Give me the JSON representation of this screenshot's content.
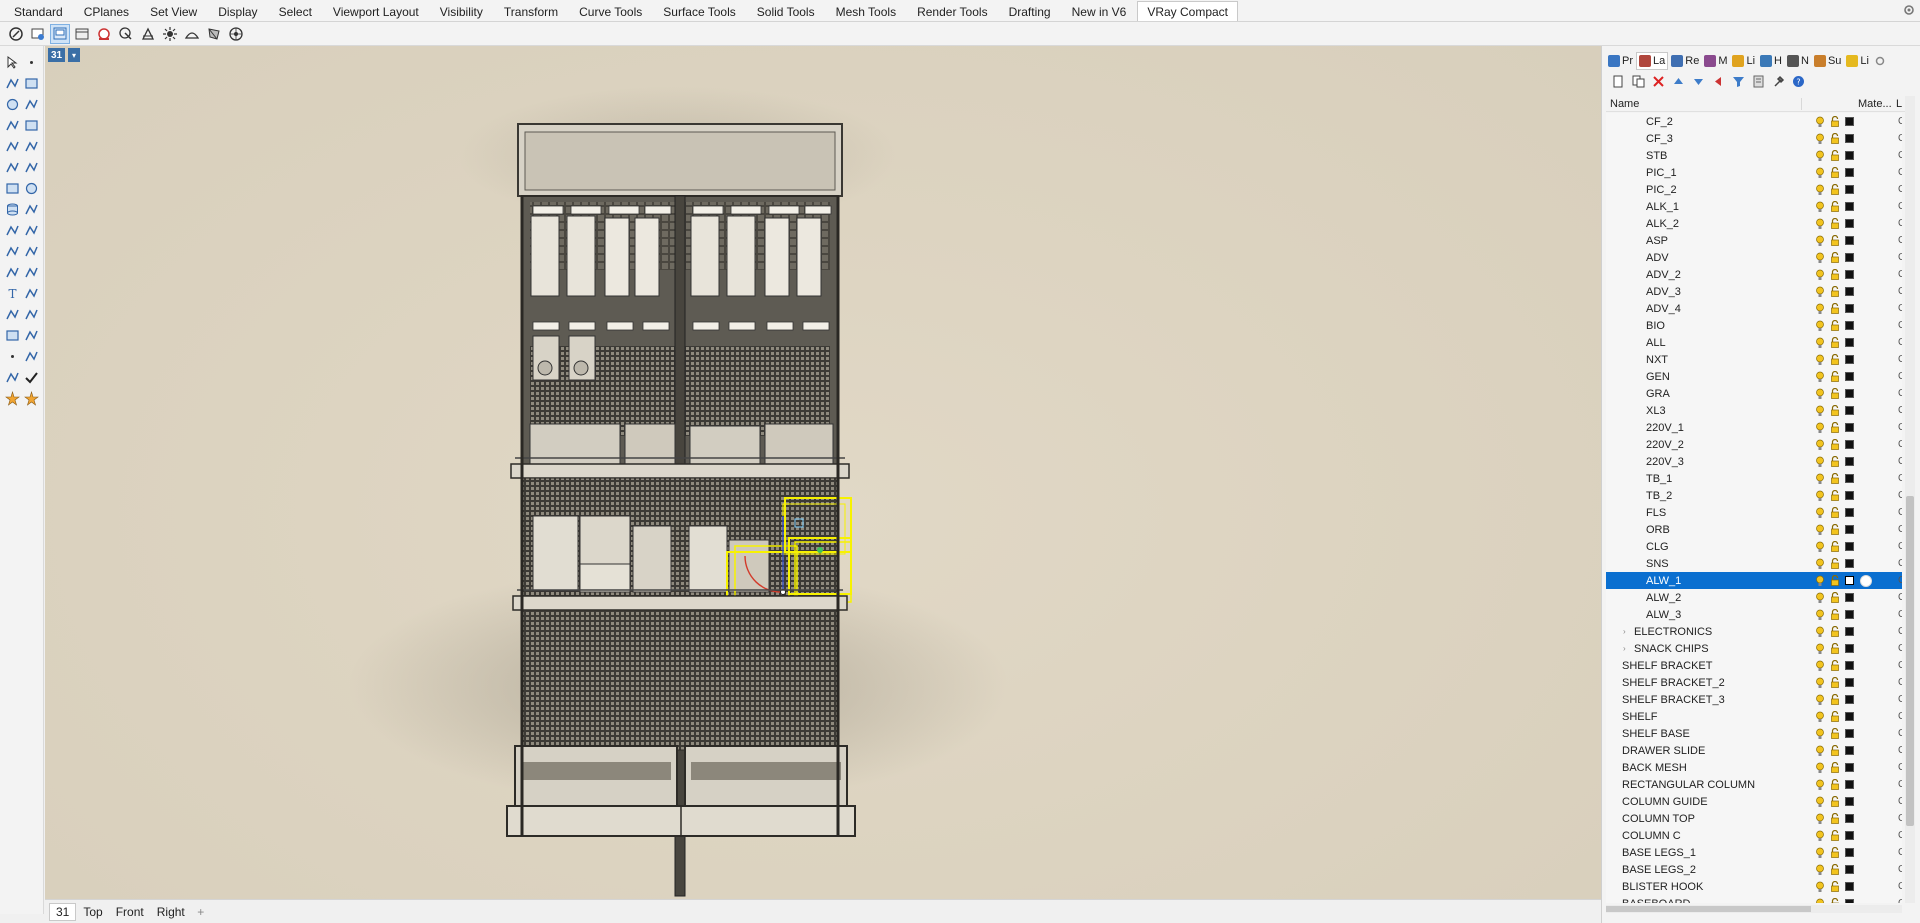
{
  "tabs": [
    {
      "label": "Standard"
    },
    {
      "label": "CPlanes"
    },
    {
      "label": "Set View"
    },
    {
      "label": "Display"
    },
    {
      "label": "Select"
    },
    {
      "label": "Viewport Layout"
    },
    {
      "label": "Visibility"
    },
    {
      "label": "Transform"
    },
    {
      "label": "Curve Tools"
    },
    {
      "label": "Surface Tools"
    },
    {
      "label": "Solid Tools"
    },
    {
      "label": "Mesh Tools"
    },
    {
      "label": "Render Tools"
    },
    {
      "label": "Drafting"
    },
    {
      "label": "New in V6"
    },
    {
      "label": "VRay Compact"
    }
  ],
  "active_tab": "VRay Compact",
  "toolbar": {
    "icons": [
      "vray-logo-icon",
      "vray-render-icon",
      "vray-frame-buffer-icon",
      "vray-interactive-icon",
      "vray-material-icon",
      "vray-sphere-icon",
      "vray-light-icon",
      "vray-sun-icon",
      "vray-dome-icon",
      "vray-proxy-icon",
      "vray-settings-icon"
    ]
  },
  "viewport": {
    "label": "31",
    "dropdown": "▾",
    "background": "#ddd4c1"
  },
  "viewport_tabs": [
    {
      "label": "31"
    },
    {
      "label": "Top"
    },
    {
      "label": "Front"
    },
    {
      "label": "Right"
    }
  ],
  "viewport_tab_add": "+",
  "panel": {
    "tabs": [
      {
        "label": "Pr",
        "color": "#3a76c2"
      },
      {
        "label": "La",
        "color": "#b0463c"
      },
      {
        "label": "Re",
        "color": "#3f6fb2"
      },
      {
        "label": "M",
        "color": "#8a4a8e"
      },
      {
        "label": "Li",
        "color": "#e0a31f"
      },
      {
        "label": "H",
        "color": "#3b79b7"
      },
      {
        "label": "N",
        "color": "#555555"
      },
      {
        "label": "Su",
        "color": "#c97e2b"
      },
      {
        "label": "Li",
        "color": "#e5b91f"
      }
    ],
    "active_tab": "La",
    "header": {
      "name": "Name",
      "material": "Mate...",
      "linetype": "L"
    },
    "layers": [
      {
        "name": "CF_2",
        "indent": 2
      },
      {
        "name": "CF_3",
        "indent": 2
      },
      {
        "name": "STB",
        "indent": 2
      },
      {
        "name": "PIC_1",
        "indent": 2
      },
      {
        "name": "PIC_2",
        "indent": 2
      },
      {
        "name": "ALK_1",
        "indent": 2
      },
      {
        "name": "ALK_2",
        "indent": 2
      },
      {
        "name": "ASP",
        "indent": 2
      },
      {
        "name": "ADV",
        "indent": 2
      },
      {
        "name": "ADV_2",
        "indent": 2
      },
      {
        "name": "ADV_3",
        "indent": 2
      },
      {
        "name": "ADV_4",
        "indent": 2
      },
      {
        "name": "BIO",
        "indent": 2
      },
      {
        "name": "ALL",
        "indent": 2
      },
      {
        "name": "NXT",
        "indent": 2
      },
      {
        "name": "GEN",
        "indent": 2
      },
      {
        "name": "GRA",
        "indent": 2
      },
      {
        "name": "XL3",
        "indent": 2
      },
      {
        "name": "220V_1",
        "indent": 2
      },
      {
        "name": "220V_2",
        "indent": 2
      },
      {
        "name": "220V_3",
        "indent": 2
      },
      {
        "name": "TB_1",
        "indent": 2
      },
      {
        "name": "TB_2",
        "indent": 2
      },
      {
        "name": "FLS",
        "indent": 2
      },
      {
        "name": "ORB",
        "indent": 2
      },
      {
        "name": "CLG",
        "indent": 2
      },
      {
        "name": "SNS",
        "indent": 2
      },
      {
        "name": "ALW_1",
        "indent": 2,
        "selected": true
      },
      {
        "name": "ALW_2",
        "indent": 2
      },
      {
        "name": "ALW_3",
        "indent": 2
      },
      {
        "name": "ELECTRONICS",
        "indent": 1,
        "expandable": true
      },
      {
        "name": "SNACK CHIPS",
        "indent": 1,
        "expandable": true
      },
      {
        "name": "SHELF BRACKET",
        "indent": 0
      },
      {
        "name": "SHELF BRACKET_2",
        "indent": 0
      },
      {
        "name": "SHELF BRACKET_3",
        "indent": 0
      },
      {
        "name": "SHELF",
        "indent": 0
      },
      {
        "name": "SHELF BASE",
        "indent": 0
      },
      {
        "name": "DRAWER SLIDE",
        "indent": 0
      },
      {
        "name": "BACK MESH",
        "indent": 0
      },
      {
        "name": "RECTANGULAR COLUMN",
        "indent": 0
      },
      {
        "name": "COLUMN GUIDE",
        "indent": 0
      },
      {
        "name": "COLUMN TOP",
        "indent": 0
      },
      {
        "name": "COLUMN C",
        "indent": 0
      },
      {
        "name": "BASE LEGS_1",
        "indent": 0
      },
      {
        "name": "BASE LEGS_2",
        "indent": 0
      },
      {
        "name": "BLISTER HOOK",
        "indent": 0
      },
      {
        "name": "BASEBOARD",
        "indent": 0
      }
    ],
    "column_l_glyph": "C"
  },
  "colors": {
    "selection_blue": "#0a6fd0",
    "viewport_label_blue": "#3b6fa6",
    "highlight_yellow": "#f7f200"
  }
}
